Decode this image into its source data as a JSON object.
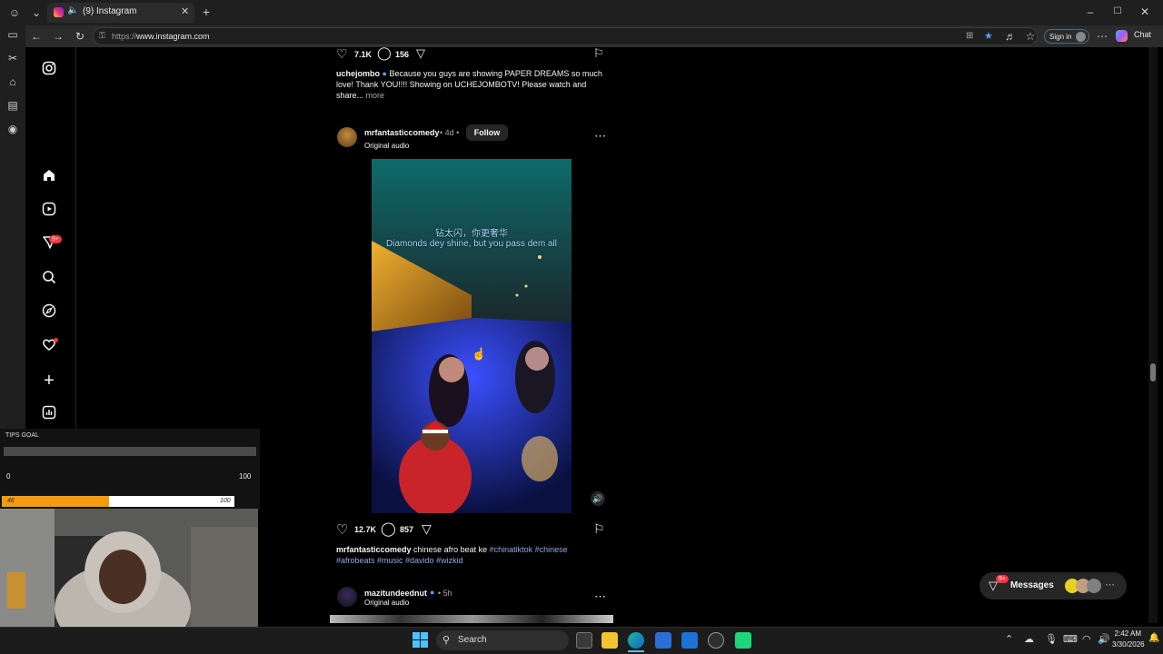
{
  "browser": {
    "tab_title": "(9) Instagram",
    "url_prefix": "https://",
    "url_host": "www.instagram.com",
    "signin_label": "Sign in",
    "chat_label": "Chat"
  },
  "ig": {
    "notifications_badge": "9+",
    "prev_post": {
      "likes": "7.1K",
      "comments": "156",
      "caption_user": "uchejombo",
      "caption_text": "Because you guys are showing PAPER DREAMS so much love! Thank YOU!!!! Showing on UCHEJOMBOTV! Please watch and share...",
      "more_label": "more"
    },
    "post": {
      "username": "mrfantasticcomedy",
      "time": "• 4d •",
      "follow_label": "Follow",
      "audio": "Original audio",
      "subtitle_cn": "钻太闪，你更奢华",
      "subtitle_en": "Diamonds dey shine, but you pass dem all",
      "likes": "12.7K",
      "comments": "857",
      "caption_user": "mrfantasticcomedy",
      "caption_text": "chinese afro beat ke",
      "hashtags_line1": "#chinatiktok #chinese",
      "hashtags_line2": "#afrobeats #music #davido #wizkid"
    },
    "next_post": {
      "username": "mazitundeednut",
      "time": "• 5h",
      "audio": "Original audio"
    },
    "messages_label": "Messages",
    "messages_badge": "9+"
  },
  "overlay": {
    "tips_label": "TIPS GOAL",
    "tips_min": "0",
    "tips_max": "100",
    "bar_value_label": "46",
    "bar_max_label": "100",
    "bar_fraction": 0.46
  },
  "taskbar": {
    "search_placeholder": "Search",
    "time": "2:42 AM",
    "date": "3/30/2026"
  },
  "colors": {
    "accent_badge": "#ff3040",
    "link": "#8fa8e8",
    "progress": "#f39c12"
  }
}
